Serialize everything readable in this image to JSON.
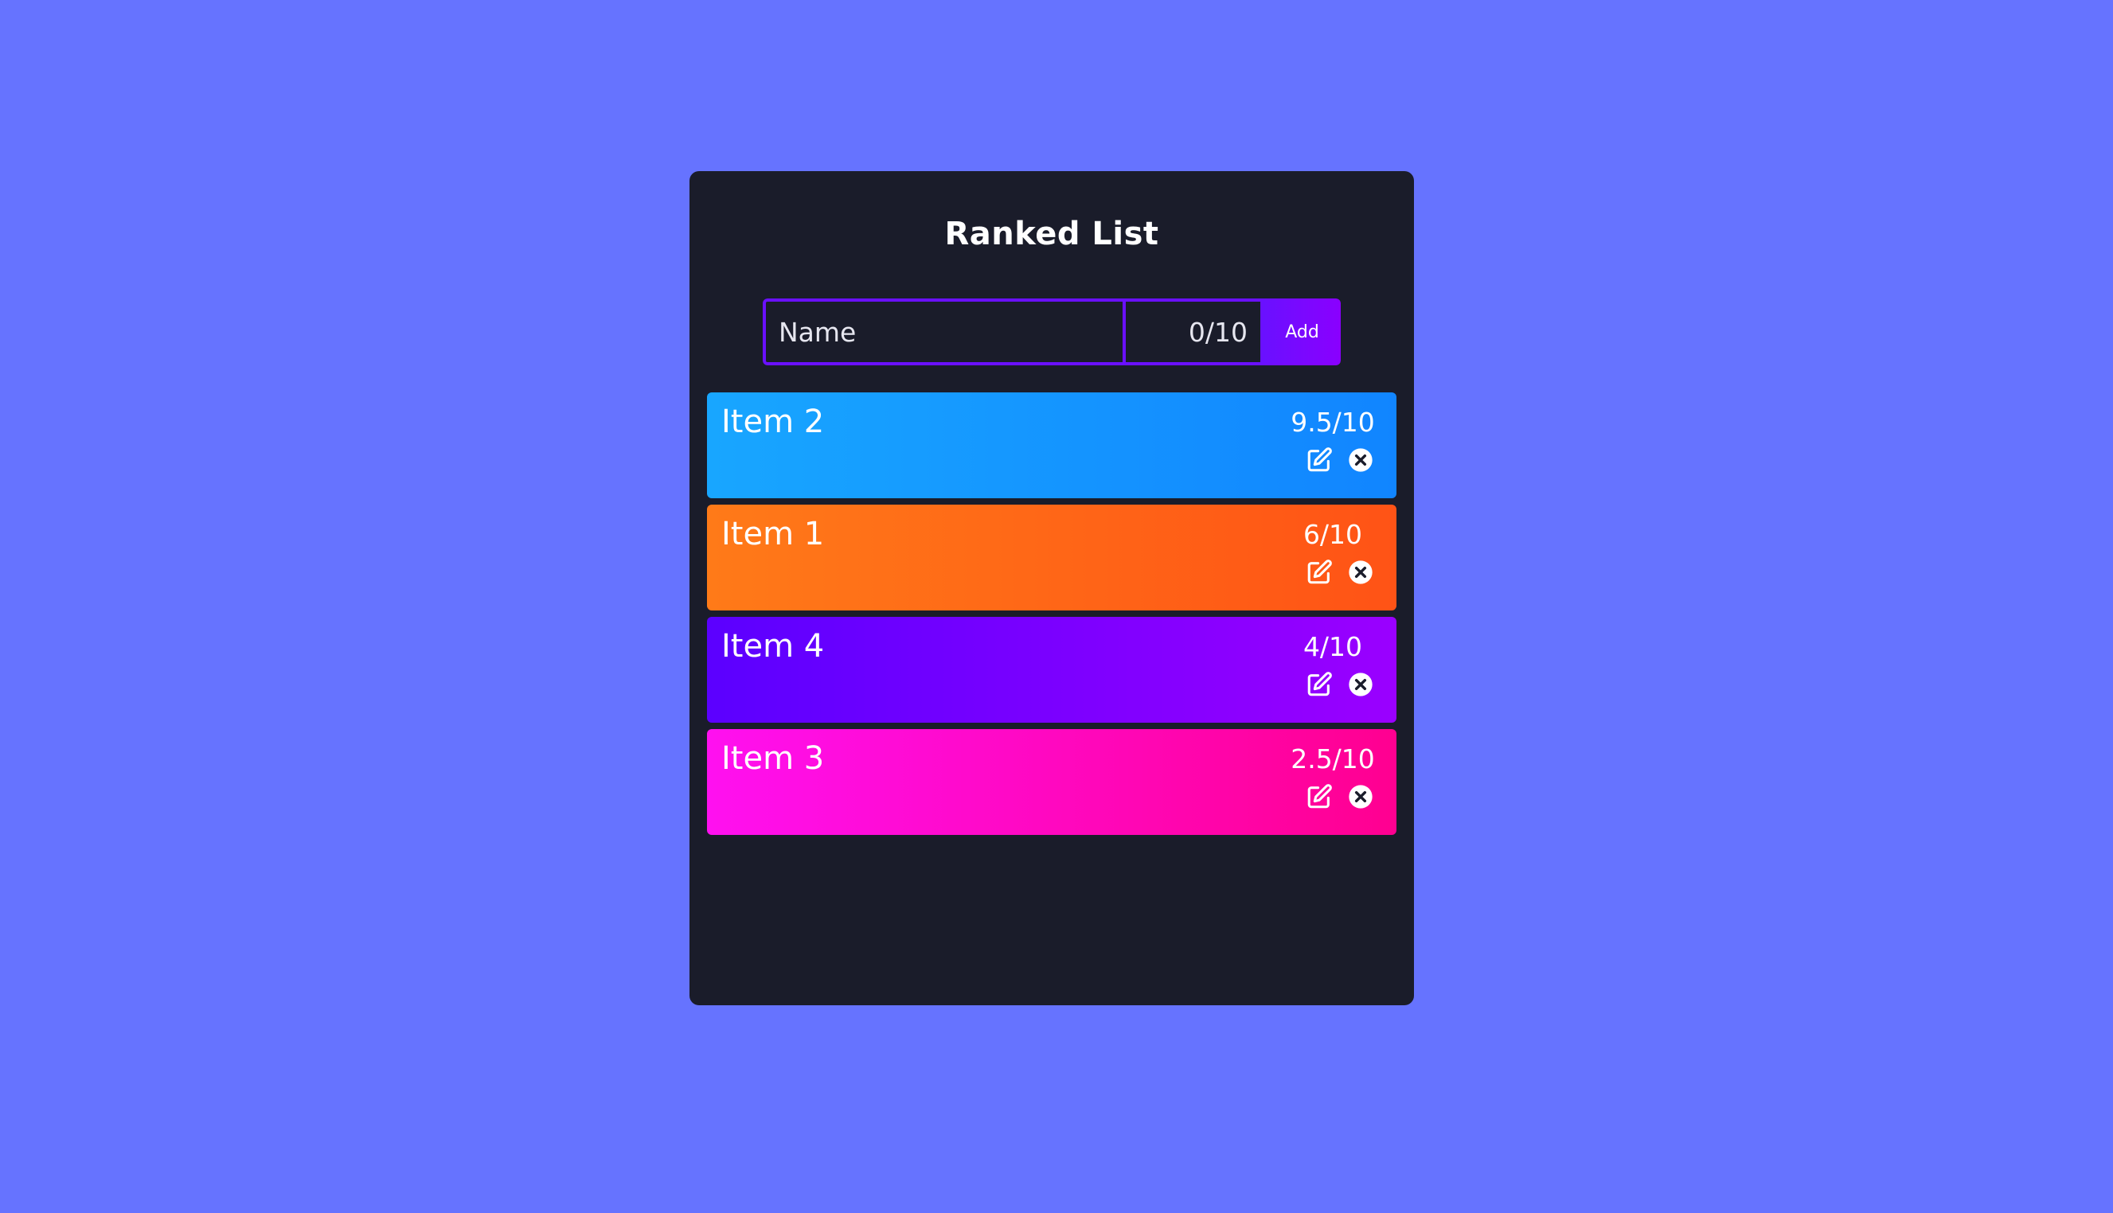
{
  "title": "Ranked List",
  "form": {
    "name_placeholder": "Name",
    "score_placeholder": "0/10",
    "add_label": "Add"
  },
  "items": [
    {
      "name": "Item 2",
      "score": "9.5/10",
      "gradient": [
        "#18a6ff",
        "#1185ff"
      ]
    },
    {
      "name": "Item 1",
      "score": "6/10",
      "gradient": [
        "#ff7a18",
        "#ff5316"
      ]
    },
    {
      "name": "Item 4",
      "score": "4/10",
      "gradient": [
        "#5b00ff",
        "#9a00ff"
      ]
    },
    {
      "name": "Item 3",
      "score": "2.5/10",
      "gradient": [
        "#ff10f0",
        "#ff0090"
      ]
    }
  ],
  "icons": {
    "edit": "edit-icon",
    "delete": "close-circle-icon"
  },
  "colors": {
    "background": "#6673ff",
    "panel": "#1a1c2a",
    "accent": "#6a10ff"
  }
}
